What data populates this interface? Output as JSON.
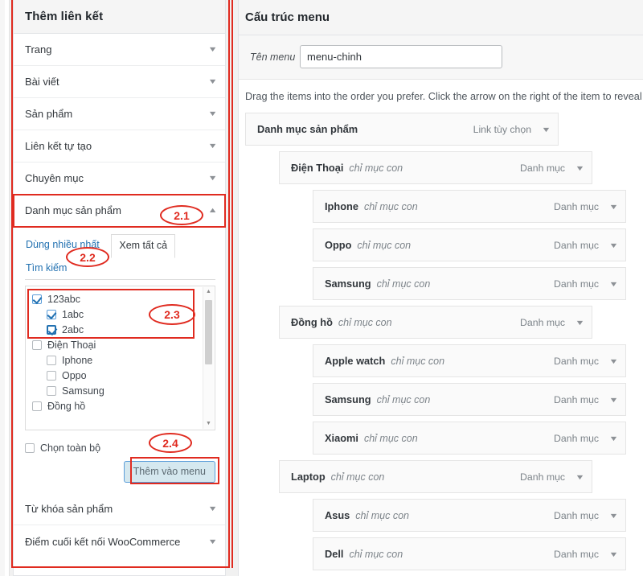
{
  "colors": {
    "annotation": "#e02b20",
    "link": "#2271b1",
    "button_bg": "#d5e8ef",
    "button_border": "#5b9dd9",
    "panel_head_bg": "#f5f5f5"
  },
  "left_panel": {
    "title": "Thêm liên kết",
    "accordion": [
      {
        "label": "Trang",
        "icon": "chevron-down-icon",
        "glyph": "▼",
        "open": false
      },
      {
        "label": "Bài viết",
        "icon": "chevron-down-icon",
        "glyph": "▼",
        "open": false
      },
      {
        "label": "Sản phẩm",
        "icon": "chevron-down-icon",
        "glyph": "▼",
        "open": false
      },
      {
        "label": "Liên kết tự tạo",
        "icon": "chevron-down-icon",
        "glyph": "▼",
        "open": false
      },
      {
        "label": "Chuyên mục",
        "icon": "chevron-down-icon",
        "glyph": "▼",
        "open": false
      },
      {
        "label": "Danh mục sản phẩm",
        "icon": "chevron-up-icon",
        "glyph": "▲",
        "open": true
      }
    ],
    "accordion_tail": [
      {
        "label": "Từ khóa sản phẩm",
        "icon": "chevron-down-icon",
        "glyph": "▼"
      },
      {
        "label": "Điểm cuối kết nối WooCommerce",
        "icon": "chevron-down-icon",
        "glyph": "▼"
      }
    ],
    "tabs": [
      {
        "label": "Dùng nhiều nhất",
        "active": false
      },
      {
        "label": "Xem tất cả",
        "active": true
      },
      {
        "label": "Tìm kiếm",
        "active": false
      }
    ],
    "checkbox_list": [
      {
        "label": "123abc",
        "level": 0,
        "checked": true,
        "strong": false
      },
      {
        "label": "1abc",
        "level": 1,
        "checked": true,
        "strong": false
      },
      {
        "label": "2abc",
        "level": 1,
        "checked": true,
        "strong": true
      },
      {
        "label": "Điện Thoại",
        "level": 0,
        "checked": false,
        "strong": false
      },
      {
        "label": "Iphone",
        "level": 1,
        "checked": false,
        "strong": false
      },
      {
        "label": "Oppo",
        "level": 1,
        "checked": false,
        "strong": false
      },
      {
        "label": "Samsung",
        "level": 1,
        "checked": false,
        "strong": false
      },
      {
        "label": "Đồng hồ",
        "level": 0,
        "checked": false,
        "strong": false
      }
    ],
    "select_all_label": "Chọn toàn bộ",
    "select_all_checked": false,
    "add_button_label": "Thêm vào menu",
    "scrollbar": {
      "up_glyph": "▲",
      "down_glyph": "▼"
    }
  },
  "right_panel": {
    "title": "Cấu trúc menu",
    "menu_name_label": "Tên menu",
    "menu_name_value": "menu-chinh",
    "menu_name_placeholder": "Tên menu",
    "hint": "Drag the items into the order you prefer. Click the arrow on the right of the item to reveal a",
    "items": [
      {
        "name": "Danh mục sản phẩm",
        "sub": "",
        "type": "Link tùy chọn",
        "depth": 0,
        "glyph": "▼"
      },
      {
        "name": "Điện Thoại",
        "sub": "chỉ mục con",
        "type": "Danh mục",
        "depth": 0,
        "glyph": "▼"
      },
      {
        "name": "Iphone",
        "sub": "chỉ mục con",
        "type": "Danh mục",
        "depth": 1,
        "glyph": "▼"
      },
      {
        "name": "Oppo",
        "sub": "chỉ mục con",
        "type": "Danh mục",
        "depth": 1,
        "glyph": "▼"
      },
      {
        "name": "Samsung",
        "sub": "chỉ mục con",
        "type": "Danh mục",
        "depth": 1,
        "glyph": "▼"
      },
      {
        "name": "Đồng hồ",
        "sub": "chỉ mục con",
        "type": "Danh mục",
        "depth": 0,
        "glyph": "▼"
      },
      {
        "name": "Apple watch",
        "sub": "chỉ mục con",
        "type": "Danh mục",
        "depth": 1,
        "glyph": "▼"
      },
      {
        "name": "Samsung",
        "sub": "chỉ mục con",
        "type": "Danh mục",
        "depth": 1,
        "glyph": "▼"
      },
      {
        "name": "Xiaomi",
        "sub": "chỉ mục con",
        "type": "Danh mục",
        "depth": 1,
        "glyph": "▼"
      },
      {
        "name": "Laptop",
        "sub": "chỉ mục con",
        "type": "Danh mục",
        "depth": 0,
        "glyph": "▼"
      },
      {
        "name": "Asus",
        "sub": "chỉ mục con",
        "type": "Danh mục",
        "depth": 1,
        "glyph": "▼"
      },
      {
        "name": "Dell",
        "sub": "chỉ mục con",
        "type": "Danh mục",
        "depth": 1,
        "glyph": "▼"
      }
    ]
  },
  "annotations": [
    {
      "id": "ann21",
      "label": "2.1"
    },
    {
      "id": "ann22",
      "label": "2.2"
    },
    {
      "id": "ann23",
      "label": "2.3"
    },
    {
      "id": "ann24",
      "label": "2.4"
    }
  ]
}
